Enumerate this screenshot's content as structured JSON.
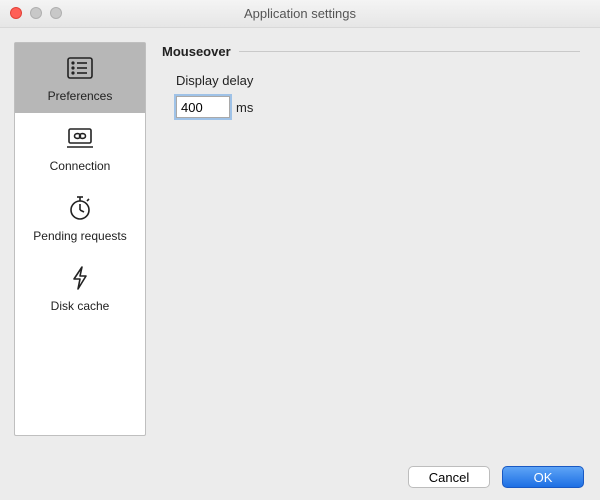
{
  "window": {
    "title": "Application settings"
  },
  "sidebar": {
    "items": [
      {
        "label": "Preferences"
      },
      {
        "label": "Connection"
      },
      {
        "label": "Pending requests"
      },
      {
        "label": "Disk cache"
      }
    ]
  },
  "main": {
    "section_title": "Mouseover",
    "display_delay_label": "Display delay",
    "display_delay_value": "400",
    "display_delay_unit": "ms"
  },
  "footer": {
    "cancel": "Cancel",
    "ok": "OK"
  }
}
